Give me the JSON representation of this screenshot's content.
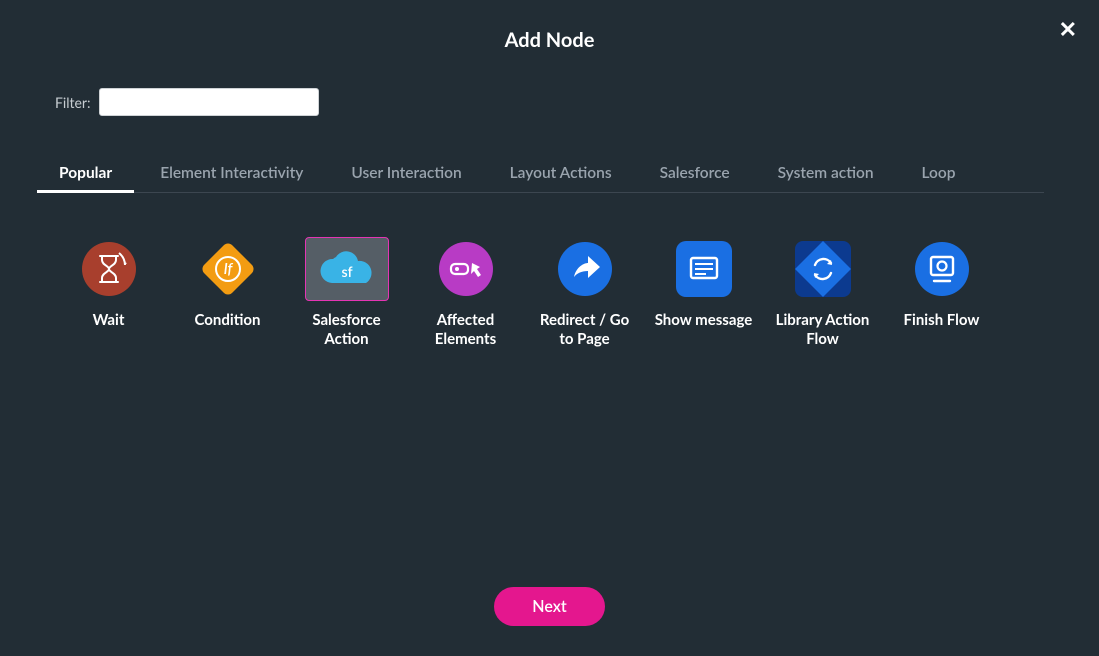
{
  "modal": {
    "title": "Add Node",
    "close_glyph": "✕",
    "next_label": "Next"
  },
  "filter": {
    "label": "Filter:",
    "value": ""
  },
  "tabs": [
    {
      "label": "Popular",
      "active": true
    },
    {
      "label": "Element Interactivity",
      "active": false
    },
    {
      "label": "User Interaction",
      "active": false
    },
    {
      "label": "Layout Actions",
      "active": false
    },
    {
      "label": "Salesforce",
      "active": false
    },
    {
      "label": "System action",
      "active": false
    },
    {
      "label": "Loop",
      "active": false
    }
  ],
  "nodes": [
    {
      "id": "wait",
      "label": "Wait",
      "selected": false
    },
    {
      "id": "condition",
      "label": "Condition",
      "selected": false
    },
    {
      "id": "salesforce-action",
      "label": "Salesforce Action",
      "selected": true
    },
    {
      "id": "affected-elements",
      "label": "Affected Elements",
      "selected": false
    },
    {
      "id": "redirect",
      "label": "Redirect / Go to Page",
      "selected": false
    },
    {
      "id": "show-message",
      "label": "Show message",
      "selected": false
    },
    {
      "id": "library-action-flow",
      "label": "Library Action Flow",
      "selected": false
    },
    {
      "id": "finish-flow",
      "label": "Finish Flow",
      "selected": false
    }
  ],
  "colors": {
    "wait": "#a83f2d",
    "condition": "#f39c12",
    "salesforce": "#39b3e6",
    "affected": "#b83bc5",
    "blue": "#1a6fe3",
    "darkblue": "#0c3a8f"
  }
}
